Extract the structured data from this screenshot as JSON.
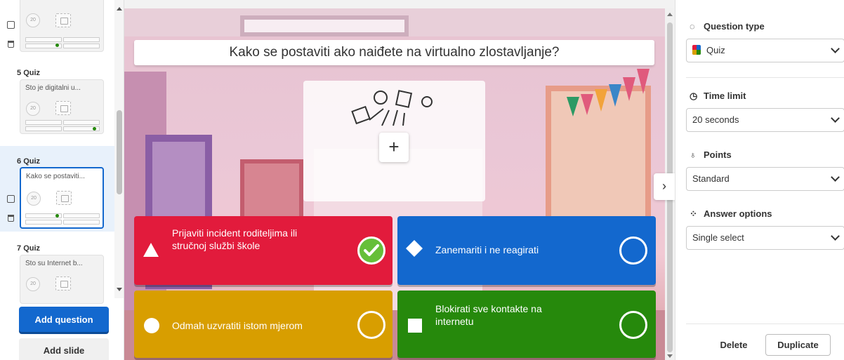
{
  "sidebar": {
    "slides": [
      {
        "number_label": "",
        "type_label": "",
        "question_preview": "",
        "timer": "20"
      },
      {
        "number_label": "5",
        "type_label": "Quiz",
        "question_preview": "Što je digitalni u...",
        "timer": "20"
      },
      {
        "number_label": "6",
        "type_label": "Quiz",
        "question_preview": "Kako se postaviti...",
        "timer": "20"
      },
      {
        "number_label": "7",
        "type_label": "Quiz",
        "question_preview": "Što su Internet b...",
        "timer": "20"
      }
    ],
    "add_question_label": "Add question",
    "add_slide_label": "Add slide"
  },
  "editor": {
    "question_text": "Kako se postaviti ako naiđete na virtualno zlostavljanje?",
    "media_add_symbol": "+",
    "answers": [
      {
        "text_line1": "Prijaviti incident roditeljima ili",
        "text_line2": "stručnoj službi škole",
        "shape": "triangle",
        "color": "#e21b3c",
        "correct": true
      },
      {
        "text_line1": "Zanemariti i ne reagirati",
        "text_line2": "",
        "shape": "diamond",
        "color": "#1368ce",
        "correct": false
      },
      {
        "text_line1": "Odmah uzvratiti istom mjerom",
        "text_line2": "",
        "shape": "circle",
        "color": "#d89e00",
        "correct": false
      },
      {
        "text_line1": "Blokirati sve kontakte na",
        "text_line2": "internetu",
        "shape": "square",
        "color": "#26890c",
        "correct": false
      }
    ],
    "collapse_symbol": "›"
  },
  "settings": {
    "question_type": {
      "label": "Question type",
      "value": "Quiz"
    },
    "time_limit": {
      "label": "Time limit",
      "value": "20 seconds"
    },
    "points": {
      "label": "Points",
      "value": "Standard"
    },
    "answer_options": {
      "label": "Answer options",
      "value": "Single select"
    },
    "delete_label": "Delete",
    "duplicate_label": "Duplicate"
  },
  "icons": {
    "question_type": "shapes-icon",
    "time_limit": "clock-icon",
    "points": "award-icon",
    "answer_options": "grid-dots-icon"
  }
}
